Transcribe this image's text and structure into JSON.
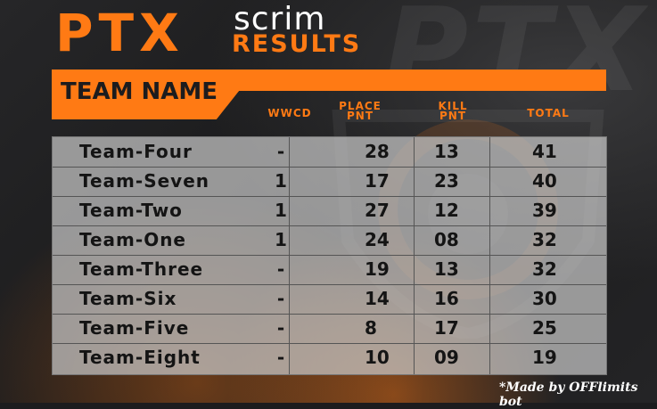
{
  "logo": {
    "main": "PTX",
    "scrim": "scrim",
    "results": "RESULTS"
  },
  "header": {
    "team_name_label": "TEAM NAME",
    "columns": {
      "wwcd": "WWCD",
      "place_line1": "PLACE",
      "place_line2": "PNT",
      "kill_line1": "KILL",
      "kill_line2": "PNT",
      "total": "TOTAL"
    }
  },
  "rows": [
    {
      "name": "Team-Four",
      "wwcd": "-",
      "place": "28",
      "kill": "13",
      "total": "41"
    },
    {
      "name": "Team-Seven",
      "wwcd": "1",
      "place": "17",
      "kill": "23",
      "total": "40"
    },
    {
      "name": "Team-Two",
      "wwcd": "1",
      "place": "27",
      "kill": "12",
      "total": "39"
    },
    {
      "name": "Team-One",
      "wwcd": "1",
      "place": "24",
      "kill": "08",
      "total": "32"
    },
    {
      "name": "Team-Three",
      "wwcd": "-",
      "place": "19",
      "kill": "13",
      "total": "32"
    },
    {
      "name": "Team-Six",
      "wwcd": "-",
      "place": "14",
      "kill": "16",
      "total": "30"
    },
    {
      "name": "Team-Five",
      "wwcd": "-",
      "place": "8",
      "kill": "17",
      "total": "25"
    },
    {
      "name": "Team-Eight",
      "wwcd": "-",
      "place": "10",
      "kill": "09",
      "total": "19"
    }
  ],
  "credit": "*Made by OFFlimits bot",
  "colors": {
    "accent": "#ff7a14",
    "table_bg": "#c8c8c8",
    "text_dark": "#141414"
  }
}
